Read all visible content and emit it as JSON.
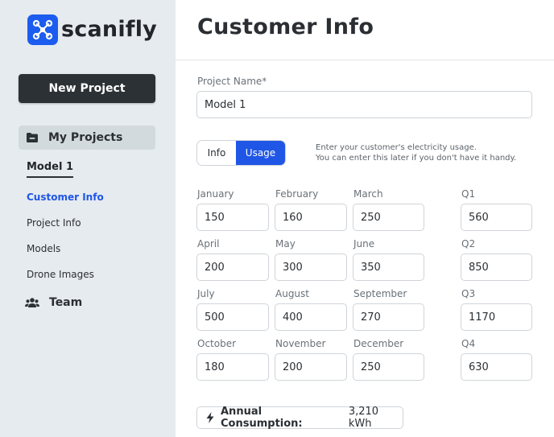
{
  "brand": {
    "name": "scanifly",
    "color": "#1c5df0"
  },
  "sidebar": {
    "new_project_label": "New Project",
    "my_projects_label": "My Projects",
    "current_model": "Model 1",
    "sub_items": [
      {
        "label": "Customer Info",
        "active": true
      },
      {
        "label": "Project Info",
        "active": false
      },
      {
        "label": "Models",
        "active": false
      },
      {
        "label": "Drone Images",
        "active": false
      }
    ],
    "team_label": "Team"
  },
  "header": {
    "title": "Customer Info"
  },
  "form": {
    "project_name_label": "Project Name*",
    "project_name_value": "Model 1",
    "toggle": {
      "info": "Info",
      "usage": "Usage",
      "selected": "Usage"
    },
    "hint_line1": "Enter your customer's electricity usage.",
    "hint_line2": "You can enter this later if you don't have it handy.",
    "months": [
      {
        "label": "January",
        "value": "150"
      },
      {
        "label": "February",
        "value": "160"
      },
      {
        "label": "March",
        "value": "250"
      },
      {
        "label": "April",
        "value": "200"
      },
      {
        "label": "May",
        "value": "300"
      },
      {
        "label": "June",
        "value": "350"
      },
      {
        "label": "July",
        "value": "500"
      },
      {
        "label": "August",
        "value": "400"
      },
      {
        "label": "September",
        "value": "270"
      },
      {
        "label": "October",
        "value": "180"
      },
      {
        "label": "November",
        "value": "200"
      },
      {
        "label": "December",
        "value": "250"
      }
    ],
    "quarters": [
      {
        "label": "Q1",
        "value": "560"
      },
      {
        "label": "Q2",
        "value": "850"
      },
      {
        "label": "Q3",
        "value": "1170"
      },
      {
        "label": "Q4",
        "value": "630"
      }
    ],
    "annual_label": "Annual Consumption:",
    "annual_value": "3,210 kWh"
  },
  "colors": {
    "accent": "#1f56e6",
    "sidebar_bg": "#e6ebef",
    "dark_button": "#2c3135"
  }
}
